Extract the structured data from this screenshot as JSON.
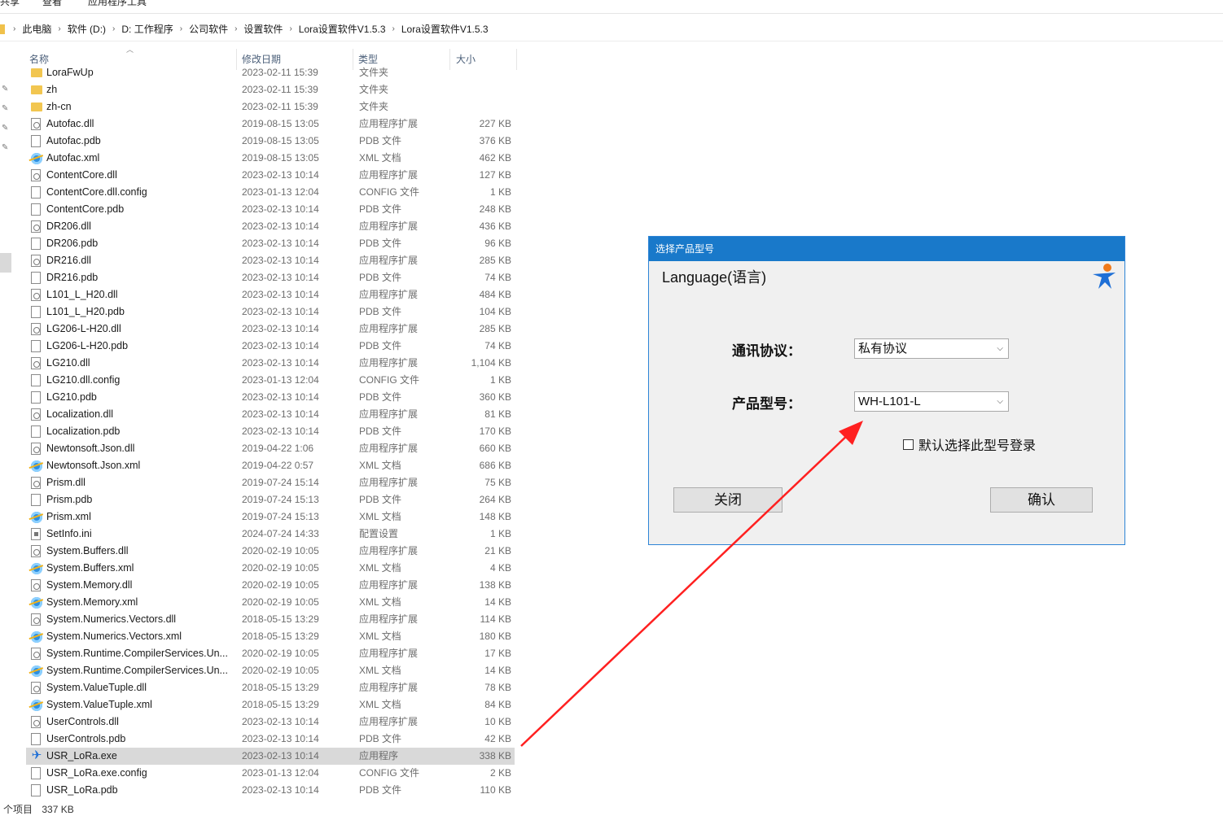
{
  "ribbon": {
    "tabs": [
      "共享",
      "查看",
      "应用程序工具"
    ]
  },
  "breadcrumb": [
    "此电脑",
    "软件 (D:)",
    "D: 工作程序",
    "公司软件",
    "设置软件",
    "Lora设置软件V1.5.3",
    "Lora设置软件V1.5.3"
  ],
  "columns": {
    "name": "名称",
    "date": "修改日期",
    "type": "类型",
    "size": "大小"
  },
  "files": [
    {
      "name": "LoraFwUp",
      "date": "2023-02-11 15:39",
      "type": "文件夹",
      "size": "",
      "icon": "folder-icon"
    },
    {
      "name": "zh",
      "date": "2023-02-11 15:39",
      "type": "文件夹",
      "size": "",
      "icon": "folder-icon"
    },
    {
      "name": "zh-cn",
      "date": "2023-02-11 15:39",
      "type": "文件夹",
      "size": "",
      "icon": "folder-icon"
    },
    {
      "name": "Autofac.dll",
      "date": "2019-08-15 13:05",
      "type": "应用程序扩展",
      "size": "227 KB",
      "icon": "dll-icon"
    },
    {
      "name": "Autofac.pdb",
      "date": "2019-08-15 13:05",
      "type": "PDB 文件",
      "size": "376 KB",
      "icon": "file-icon"
    },
    {
      "name": "Autofac.xml",
      "date": "2019-08-15 13:05",
      "type": "XML 文档",
      "size": "462 KB",
      "icon": "xml-icon"
    },
    {
      "name": "ContentCore.dll",
      "date": "2023-02-13 10:14",
      "type": "应用程序扩展",
      "size": "127 KB",
      "icon": "dll-icon"
    },
    {
      "name": "ContentCore.dll.config",
      "date": "2023-01-13 12:04",
      "type": "CONFIG 文件",
      "size": "1 KB",
      "icon": "file-icon"
    },
    {
      "name": "ContentCore.pdb",
      "date": "2023-02-13 10:14",
      "type": "PDB 文件",
      "size": "248 KB",
      "icon": "file-icon"
    },
    {
      "name": "DR206.dll",
      "date": "2023-02-13 10:14",
      "type": "应用程序扩展",
      "size": "436 KB",
      "icon": "dll-icon"
    },
    {
      "name": "DR206.pdb",
      "date": "2023-02-13 10:14",
      "type": "PDB 文件",
      "size": "96 KB",
      "icon": "file-icon"
    },
    {
      "name": "DR216.dll",
      "date": "2023-02-13 10:14",
      "type": "应用程序扩展",
      "size": "285 KB",
      "icon": "dll-icon"
    },
    {
      "name": "DR216.pdb",
      "date": "2023-02-13 10:14",
      "type": "PDB 文件",
      "size": "74 KB",
      "icon": "file-icon"
    },
    {
      "name": "L101_L_H20.dll",
      "date": "2023-02-13 10:14",
      "type": "应用程序扩展",
      "size": "484 KB",
      "icon": "dll-icon"
    },
    {
      "name": "L101_L_H20.pdb",
      "date": "2023-02-13 10:14",
      "type": "PDB 文件",
      "size": "104 KB",
      "icon": "file-icon"
    },
    {
      "name": "LG206-L-H20.dll",
      "date": "2023-02-13 10:14",
      "type": "应用程序扩展",
      "size": "285 KB",
      "icon": "dll-icon"
    },
    {
      "name": "LG206-L-H20.pdb",
      "date": "2023-02-13 10:14",
      "type": "PDB 文件",
      "size": "74 KB",
      "icon": "file-icon"
    },
    {
      "name": "LG210.dll",
      "date": "2023-02-13 10:14",
      "type": "应用程序扩展",
      "size": "1,104 KB",
      "icon": "dll-icon"
    },
    {
      "name": "LG210.dll.config",
      "date": "2023-01-13 12:04",
      "type": "CONFIG 文件",
      "size": "1 KB",
      "icon": "file-icon"
    },
    {
      "name": "LG210.pdb",
      "date": "2023-02-13 10:14",
      "type": "PDB 文件",
      "size": "360 KB",
      "icon": "file-icon"
    },
    {
      "name": "Localization.dll",
      "date": "2023-02-13 10:14",
      "type": "应用程序扩展",
      "size": "81 KB",
      "icon": "dll-icon"
    },
    {
      "name": "Localization.pdb",
      "date": "2023-02-13 10:14",
      "type": "PDB 文件",
      "size": "170 KB",
      "icon": "file-icon"
    },
    {
      "name": "Newtonsoft.Json.dll",
      "date": "2019-04-22 1:06",
      "type": "应用程序扩展",
      "size": "660 KB",
      "icon": "dll-icon"
    },
    {
      "name": "Newtonsoft.Json.xml",
      "date": "2019-04-22 0:57",
      "type": "XML 文档",
      "size": "686 KB",
      "icon": "xml-icon"
    },
    {
      "name": "Prism.dll",
      "date": "2019-07-24 15:14",
      "type": "应用程序扩展",
      "size": "75 KB",
      "icon": "dll-icon"
    },
    {
      "name": "Prism.pdb",
      "date": "2019-07-24 15:13",
      "type": "PDB 文件",
      "size": "264 KB",
      "icon": "file-icon"
    },
    {
      "name": "Prism.xml",
      "date": "2019-07-24 15:13",
      "type": "XML 文档",
      "size": "148 KB",
      "icon": "xml-icon"
    },
    {
      "name": "SetInfo.ini",
      "date": "2024-07-24 14:33",
      "type": "配置设置",
      "size": "1 KB",
      "icon": "ini-icon"
    },
    {
      "name": "System.Buffers.dll",
      "date": "2020-02-19 10:05",
      "type": "应用程序扩展",
      "size": "21 KB",
      "icon": "dll-icon"
    },
    {
      "name": "System.Buffers.xml",
      "date": "2020-02-19 10:05",
      "type": "XML 文档",
      "size": "4 KB",
      "icon": "xml-icon"
    },
    {
      "name": "System.Memory.dll",
      "date": "2020-02-19 10:05",
      "type": "应用程序扩展",
      "size": "138 KB",
      "icon": "dll-icon"
    },
    {
      "name": "System.Memory.xml",
      "date": "2020-02-19 10:05",
      "type": "XML 文档",
      "size": "14 KB",
      "icon": "xml-icon"
    },
    {
      "name": "System.Numerics.Vectors.dll",
      "date": "2018-05-15 13:29",
      "type": "应用程序扩展",
      "size": "114 KB",
      "icon": "dll-icon"
    },
    {
      "name": "System.Numerics.Vectors.xml",
      "date": "2018-05-15 13:29",
      "type": "XML 文档",
      "size": "180 KB",
      "icon": "xml-icon"
    },
    {
      "name": "System.Runtime.CompilerServices.Un...",
      "date": "2020-02-19 10:05",
      "type": "应用程序扩展",
      "size": "17 KB",
      "icon": "dll-icon"
    },
    {
      "name": "System.Runtime.CompilerServices.Un...",
      "date": "2020-02-19 10:05",
      "type": "XML 文档",
      "size": "14 KB",
      "icon": "xml-icon"
    },
    {
      "name": "System.ValueTuple.dll",
      "date": "2018-05-15 13:29",
      "type": "应用程序扩展",
      "size": "78 KB",
      "icon": "dll-icon"
    },
    {
      "name": "System.ValueTuple.xml",
      "date": "2018-05-15 13:29",
      "type": "XML 文档",
      "size": "84 KB",
      "icon": "xml-icon"
    },
    {
      "name": "UserControls.dll",
      "date": "2023-02-13 10:14",
      "type": "应用程序扩展",
      "size": "10 KB",
      "icon": "dll-icon"
    },
    {
      "name": "UserControls.pdb",
      "date": "2023-02-13 10:14",
      "type": "PDB 文件",
      "size": "42 KB",
      "icon": "file-icon"
    },
    {
      "name": "USR_LoRa.exe",
      "date": "2023-02-13 10:14",
      "type": "应用程序",
      "size": "338 KB",
      "icon": "exe-icon",
      "selected": true
    },
    {
      "name": "USR_LoRa.exe.config",
      "date": "2023-01-13 12:04",
      "type": "CONFIG 文件",
      "size": "2 KB",
      "icon": "file-icon"
    },
    {
      "name": "USR_LoRa.pdb",
      "date": "2023-02-13 10:14",
      "type": "PDB 文件",
      "size": "110 KB",
      "icon": "file-icon"
    }
  ],
  "status": {
    "count": "个项目",
    "selection": "337 KB"
  },
  "dialog": {
    "title": "选择产品型号",
    "language_link": "Language(语言)",
    "protocol_label": "通讯协议：",
    "protocol_value": "私有协议",
    "model_label": "产品型号：",
    "model_value": "WH-L101-L",
    "default_checkbox_label": "默认选择此型号登录",
    "default_checked": false,
    "close_button": "关闭",
    "confirm_button": "确认"
  },
  "colors": {
    "title_bar": "#1979ca",
    "selection": "#d9d9d9",
    "annotation_arrow": "#ff2020"
  }
}
